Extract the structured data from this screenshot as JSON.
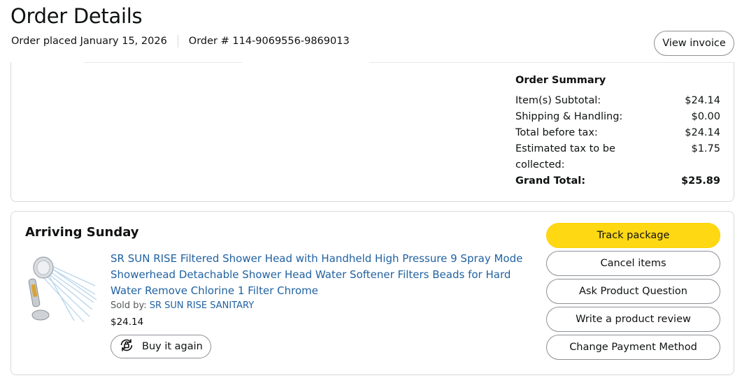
{
  "header": {
    "title": "Order Details",
    "order_placed": "Order placed January 15, 2026",
    "order_number": "Order # 114-9069556-9869013",
    "view_invoice": "View invoice"
  },
  "summary": {
    "title": "Order Summary",
    "rows": [
      {
        "label": "Item(s) Subtotal:",
        "value": "$24.14"
      },
      {
        "label": "Shipping & Handling:",
        "value": "$0.00"
      },
      {
        "label": "Total before tax:",
        "value": "$24.14"
      },
      {
        "label": "Estimated tax to be collected:",
        "value": "$1.75"
      }
    ],
    "grand_total_label": "Grand Total:",
    "grand_total_value": "$25.89"
  },
  "shipment": {
    "heading": "Arriving Sunday",
    "product_title": "SR SUN RISE Filtered Shower Head with Handheld High Pressure 9 Spray Mode Showerhead Detachable Shower Head Water Softener Filters Beads for Hard Water Remove Chlorine 1 Filter Chrome",
    "sold_by_label": "Sold by: ",
    "seller": "SR SUN RISE SANITARY",
    "price": "$24.14",
    "buy_again": "Buy it again",
    "buy_again_icon": "refresh-icon"
  },
  "actions": {
    "track": "Track package",
    "cancel": "Cancel items",
    "ask": "Ask Product Question",
    "review": "Write a product review",
    "change_payment": "Change Payment Method"
  },
  "colors": {
    "primary_button": "#ffd814",
    "link": "#2162a1",
    "border": "#d5d9d9"
  }
}
